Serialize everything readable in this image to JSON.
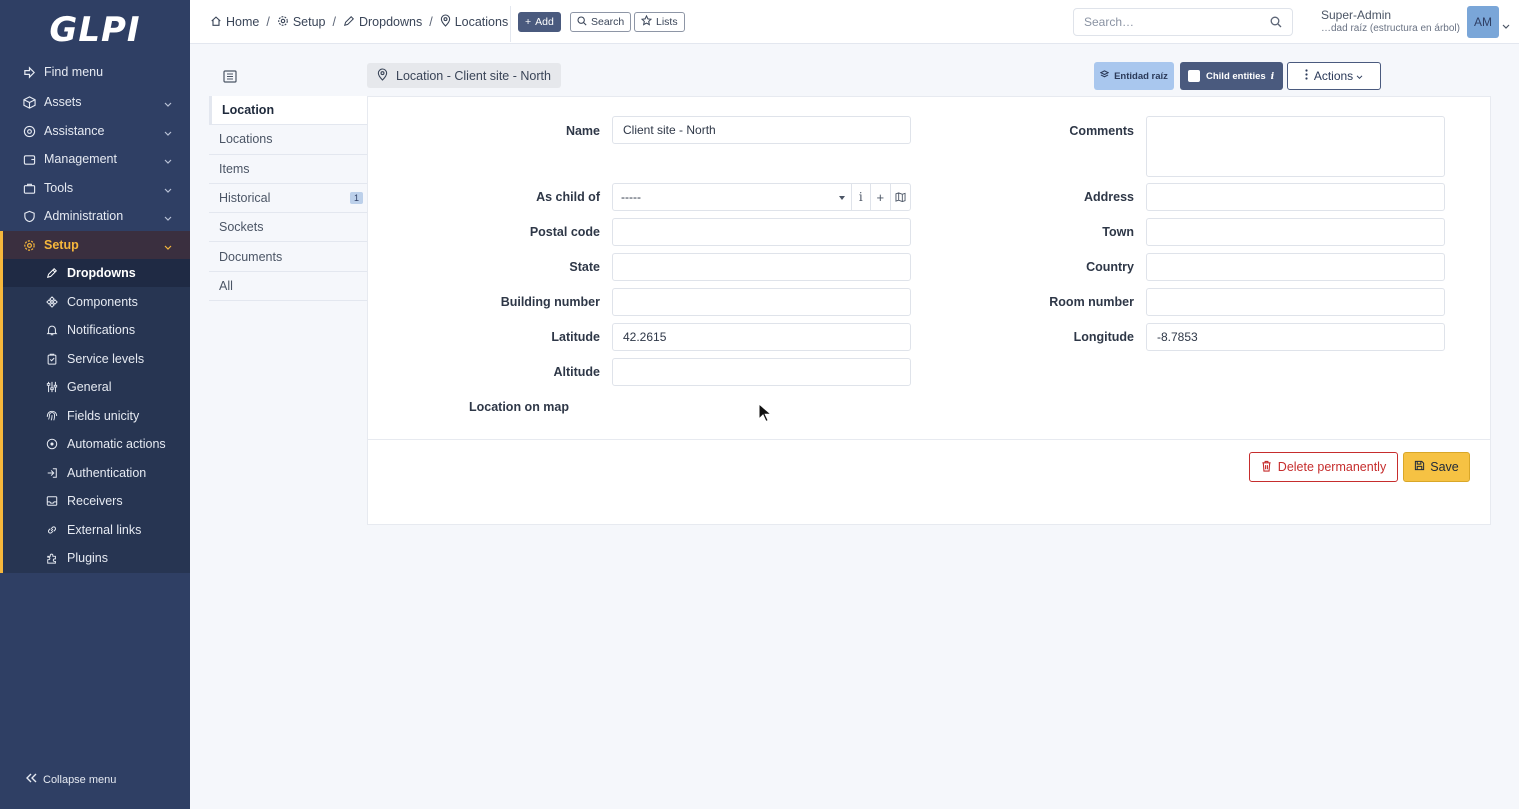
{
  "app": {
    "logo": "GLPI"
  },
  "sidebar": {
    "items": [
      {
        "label": "Find menu",
        "icon": "arrow-right-icon"
      },
      {
        "label": "Assets",
        "icon": "box-icon"
      },
      {
        "label": "Assistance",
        "icon": "headset-icon"
      },
      {
        "label": "Management",
        "icon": "wallet-icon"
      },
      {
        "label": "Tools",
        "icon": "briefcase-icon"
      },
      {
        "label": "Administration",
        "icon": "shield-icon"
      },
      {
        "label": "Setup",
        "icon": "gear-icon"
      }
    ],
    "setup_items": [
      {
        "label": "Dropdowns",
        "icon": "edit-icon"
      },
      {
        "label": "Components",
        "icon": "components-icon"
      },
      {
        "label": "Notifications",
        "icon": "bell-icon"
      },
      {
        "label": "Service levels",
        "icon": "clipboard-icon"
      },
      {
        "label": "General",
        "icon": "sliders-icon"
      },
      {
        "label": "Fields unicity",
        "icon": "fingerprint-icon"
      },
      {
        "label": "Automatic actions",
        "icon": "robot-icon"
      },
      {
        "label": "Authentication",
        "icon": "login-icon"
      },
      {
        "label": "Receivers",
        "icon": "inbox-icon"
      },
      {
        "label": "External links",
        "icon": "link-icon"
      },
      {
        "label": "Plugins",
        "icon": "puzzle-icon"
      }
    ],
    "collapse_label": "Collapse menu"
  },
  "header": {
    "breadcrumb": {
      "home": "Home",
      "setup": "Setup",
      "dropdowns": "Dropdowns",
      "locations": "Locations"
    },
    "add_label": "Add",
    "search_label": "Search",
    "lists_label": "Lists",
    "search_placeholder": "Search…",
    "user_name": "Super-Admin",
    "user_entity": "…dad raíz (estructura en árbol)",
    "avatar_initials": "AM"
  },
  "toolbar": {
    "item_title": "Location - Client site - North",
    "entity_label": "Entidad raíz",
    "child_entities_label": "Child entities",
    "actions_label": "Actions"
  },
  "tabs": [
    {
      "label": "Location"
    },
    {
      "label": "Locations"
    },
    {
      "label": "Items"
    },
    {
      "label": "Historical",
      "badge": "1"
    },
    {
      "label": "Sockets"
    },
    {
      "label": "Documents"
    },
    {
      "label": "All"
    }
  ],
  "form": {
    "name_label": "Name",
    "name_value": "Client site - North",
    "comments_label": "Comments",
    "as_child_of_label": "As child of",
    "as_child_of_value": "-----",
    "address_label": "Address",
    "postal_code_label": "Postal code",
    "town_label": "Town",
    "state_label": "State",
    "country_label": "Country",
    "building_number_label": "Building number",
    "room_number_label": "Room number",
    "latitude_label": "Latitude",
    "latitude_value": "42.2615",
    "longitude_label": "Longitude",
    "longitude_value": "-8.7853",
    "altitude_label": "Altitude",
    "map_label": "Location on map"
  },
  "footer_buttons": {
    "delete_label": "Delete permanently",
    "save_label": "Save"
  },
  "colors": {
    "sidebar_bg": "#2f3f64",
    "accent": "#f6b73c",
    "save": "#f6c243",
    "danger": "#c62d2d"
  }
}
